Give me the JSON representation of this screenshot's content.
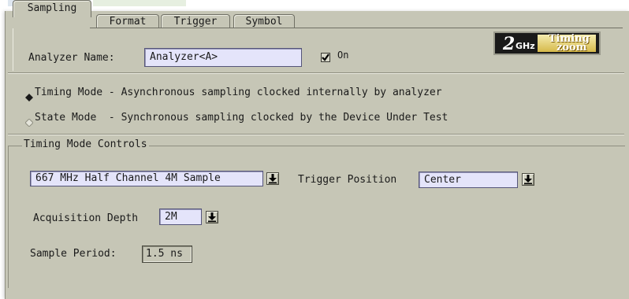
{
  "tabs": [
    {
      "label": "Sampling"
    },
    {
      "label": "Format"
    },
    {
      "label": "Trigger"
    },
    {
      "label": "Symbol"
    }
  ],
  "analyzer": {
    "name_label": "Analyzer Name:",
    "name_value": "Analyzer<A>",
    "on_label": "On",
    "on_checked": true
  },
  "logo": {
    "big": "2",
    "ghz": "GHz",
    "timing": "Timing",
    "zoom": "zoom"
  },
  "modes": [
    {
      "label": "Timing Mode - Asynchronous sampling clocked internally by analyzer",
      "selected": true
    },
    {
      "label": "State Mode  - Synchronous sampling clocked by the Device Under Test",
      "selected": false
    }
  ],
  "timing_controls": {
    "group_title": "Timing Mode Controls",
    "sample_mode": "667 MHz Half Channel 4M Sample",
    "trigger_position_label": "Trigger Position",
    "trigger_position_value": "Center",
    "acquisition_depth_label": "Acquisition Depth",
    "acquisition_depth_value": "2M",
    "sample_period_label": "Sample Period:",
    "sample_period_value": "1.5 ns"
  }
}
